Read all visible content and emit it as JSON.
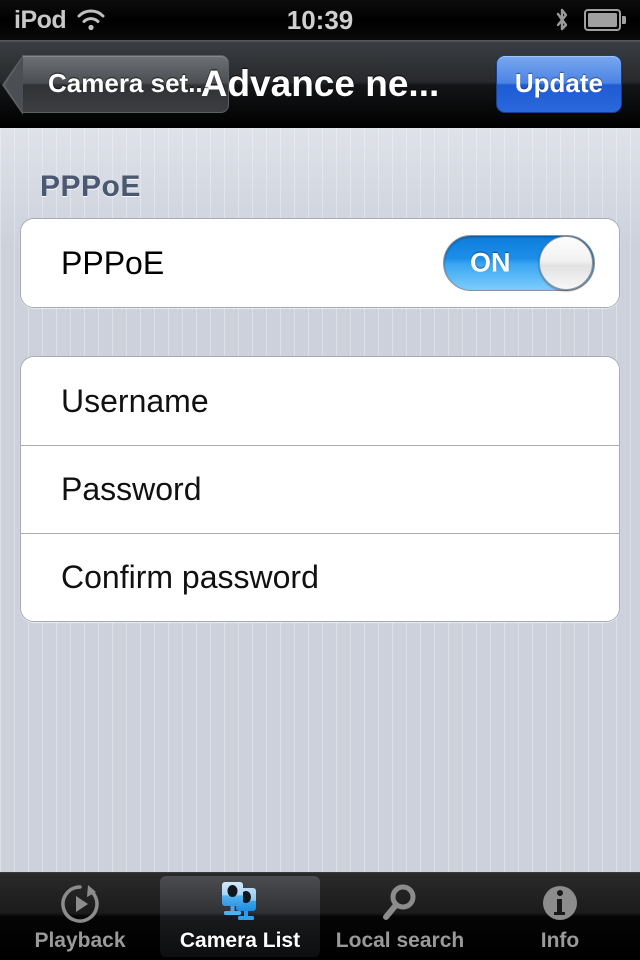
{
  "statusbar": {
    "carrier": "iPod",
    "wifi_icon": "wifi-icon",
    "time": "10:39",
    "bluetooth_icon": "bluetooth-icon",
    "battery_icon": "battery-icon"
  },
  "navbar": {
    "back_label": "Camera set...",
    "title": "Advance ne...",
    "update_label": "Update"
  },
  "content": {
    "section_header": "PPPoE",
    "pppoe_row": {
      "label": "PPPoE",
      "toggle_state": "ON"
    },
    "credential_rows": [
      {
        "placeholder": "Username"
      },
      {
        "placeholder": "Password"
      },
      {
        "placeholder": "Confirm password"
      }
    ]
  },
  "tabbar": {
    "tabs": [
      {
        "label": "Playback",
        "icon": "replay-icon",
        "selected": false
      },
      {
        "label": "Camera List",
        "icon": "cameras-icon",
        "selected": true
      },
      {
        "label": "Local search",
        "icon": "magnifier-icon",
        "selected": false
      },
      {
        "label": "Info",
        "icon": "info-circle-icon",
        "selected": false
      }
    ]
  },
  "colors": {
    "accent_blue": "#2a68de",
    "toggle_blue": "#1d8ee8",
    "background": "#ccd1dc",
    "section_header_text": "#4b5870"
  }
}
